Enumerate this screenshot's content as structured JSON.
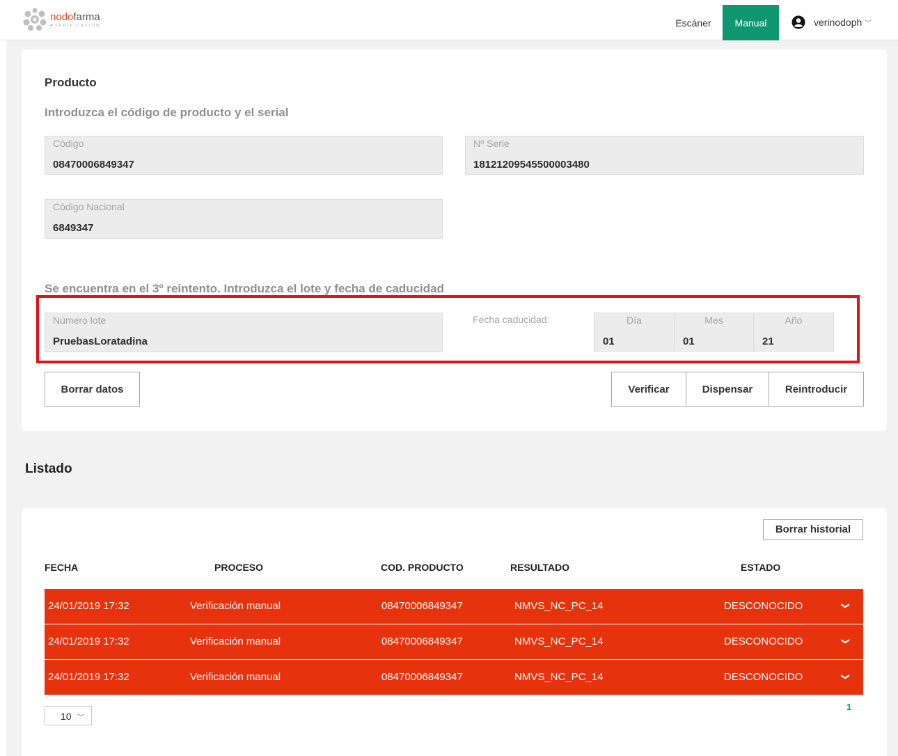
{
  "header": {
    "logo": {
      "name_part1": "nodo",
      "name_part2": "farma",
      "subtitle": "VERIFICACIÓN"
    },
    "nav": {
      "scanner": "Escáner",
      "manual": "Manual"
    },
    "user": {
      "name": "verinodoph",
      "icon": "user-circle-icon"
    },
    "accent_color": "#0f9770"
  },
  "product": {
    "title": "Producto",
    "subtitle": "Introduzca el código de producto y el serial",
    "codigo": {
      "label": "Código",
      "value": "08470006849347"
    },
    "serie": {
      "label": "Nº Serie",
      "value": "18121209545500003480"
    },
    "codigo_nacional": {
      "label": "Código Nacional",
      "value": "6849347"
    },
    "retry_notice": "Se encuentra en el 3º reintento. Introduzca el lote y fecha de caducidad",
    "lote": {
      "label": "Número lote",
      "value": "PruebasLoratadina"
    },
    "fecha": {
      "label": "Fecha caducidad:",
      "dia": {
        "label": "Día",
        "value": "01"
      },
      "mes": {
        "label": "Mes",
        "value": "01"
      },
      "anio": {
        "label": "Año",
        "value": "21"
      }
    },
    "highlight_color": "#e2111a",
    "buttons": {
      "borrar_datos": "Borrar datos",
      "verificar": "Verificar",
      "dispensar": "Dispensar",
      "reintroducir": "Reintroducir"
    }
  },
  "listado": {
    "title": "Listado",
    "clear_button": "Borrar historial",
    "columns": [
      "FECHA",
      "PROCESO",
      "COD. PRODUCTO",
      "RESULTADO",
      "ESTADO"
    ],
    "rows": [
      {
        "fecha": "24/01/2019 17:32",
        "proceso": "Verificación manual",
        "cod_producto": "08470006849347",
        "resultado": "NMVS_NC_PC_14",
        "estado": "DESCONOCIDO"
      },
      {
        "fecha": "24/01/2019 17:32",
        "proceso": "Verificación manual",
        "cod_producto": "08470006849347",
        "resultado": "NMVS_NC_PC_14",
        "estado": "DESCONOCIDO"
      },
      {
        "fecha": "24/01/2019 17:32",
        "proceso": "Verificación manual",
        "cod_producto": "08470006849347",
        "resultado": "NMVS_NC_PC_14",
        "estado": "DESCONOCIDO"
      }
    ],
    "row_color": "#e7320e",
    "page_size": "10",
    "current_page": "1"
  }
}
